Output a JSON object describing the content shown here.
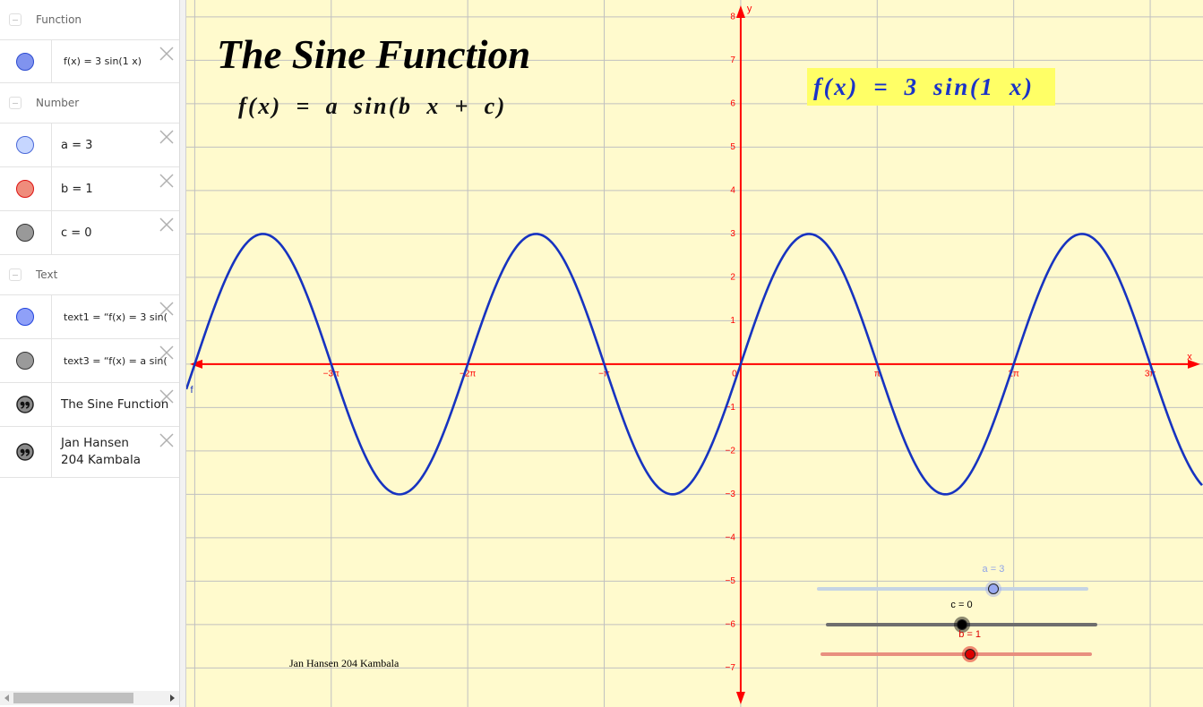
{
  "algebra": {
    "headers": {
      "function": "Function",
      "number": "Number",
      "text": "Text"
    },
    "rows": [
      {
        "text": "f(x)  =  3  sin(1 x)",
        "icon": "dot",
        "fill": "#8093ef",
        "stroke": "#2c4bd0"
      },
      {
        "text": "a = 3",
        "icon": "dot",
        "fill": "#c6d6ff",
        "stroke": "#4a68d8"
      },
      {
        "text": "b = 1",
        "icon": "dot",
        "fill": "#ef8c7c",
        "stroke": "#dd1111"
      },
      {
        "text": "c = 0",
        "icon": "dot",
        "fill": "#999999",
        "stroke": "#333333"
      },
      {
        "text": "text1  =  “f(x)  =  3  sin(",
        "icon": "dot",
        "fill": "#8fa0f8",
        "stroke": "#2244dd"
      },
      {
        "text": "text3  =  “f(x)  =  a  sin(",
        "icon": "dot",
        "fill": "#9a9a9a",
        "stroke": "#333333"
      },
      {
        "text": "The Sine Function",
        "icon": "quote"
      },
      {
        "text": "Jan Hansen 204 Kambala",
        "icon": "quote"
      }
    ],
    "scroll": {
      "position": 0,
      "thumb_fraction": 0.7
    }
  },
  "graphics": {
    "title": "The Sine Function",
    "formula": "f(x) = a sin(b x + c)",
    "highlight": {
      "text": "f(x) = 3 sin(1 x)",
      "background": "#ffff66",
      "color": "#1a33c8"
    },
    "author": "Jan Hansen 204 Kambala",
    "background": "#fffacd"
  },
  "sliders": [
    {
      "name": "a",
      "label": "a = 3",
      "value": 3,
      "position": 0.65,
      "label_color": "#8fa3e8",
      "track": "#c5d4e4",
      "knob": "#99a9f0"
    },
    {
      "name": "c",
      "label": "c = 0",
      "value": 0,
      "position": 0.5,
      "label_color": "#000000",
      "track": "#6e6e6e",
      "knob": "#000000"
    },
    {
      "name": "b",
      "label": "b = 1",
      "value": 1,
      "position": 0.55,
      "label_color": "#dd0000",
      "track": "#e88f7f",
      "knob": "#dd0000"
    }
  ],
  "chart_data": {
    "type": "line",
    "title": "",
    "xlabel": "x",
    "ylabel": "y",
    "origin_label": "0",
    "xlim": [
      -12.76,
      10.64
    ],
    "ylim": [
      -7.9,
      8.39
    ],
    "grid": true,
    "x_grid_step": 3.14159265,
    "y_grid_step": 1,
    "axis_color": "#ff0000",
    "grid_color": "#c0c0c0",
    "x_ticks": [
      {
        "value": -9.42478,
        "label": "−3π"
      },
      {
        "value": -6.28319,
        "label": "−2π"
      },
      {
        "value": -3.14159,
        "label": "−π"
      },
      {
        "value": 3.14159,
        "label": "π"
      },
      {
        "value": 6.28319,
        "label": "2π"
      },
      {
        "value": 9.42478,
        "label": "3π"
      }
    ],
    "y_ticks": [
      {
        "value": 8,
        "label": "8"
      },
      {
        "value": 7,
        "label": "7"
      },
      {
        "value": 6,
        "label": "6"
      },
      {
        "value": 5,
        "label": "5"
      },
      {
        "value": 4,
        "label": "4"
      },
      {
        "value": 3,
        "label": "3"
      },
      {
        "value": 2,
        "label": "2"
      },
      {
        "value": 1,
        "label": "1"
      },
      {
        "value": -1,
        "label": "−1"
      },
      {
        "value": -2,
        "label": "−2"
      },
      {
        "value": -3,
        "label": "−3"
      },
      {
        "value": -4,
        "label": "−4"
      },
      {
        "value": -5,
        "label": "−5"
      },
      {
        "value": -6,
        "label": "−6"
      },
      {
        "value": -7,
        "label": "−7"
      }
    ],
    "series": [
      {
        "name": "f",
        "expression": "f(x) = 3 sin(1 x)",
        "a": 3,
        "b": 1,
        "c": 0,
        "color": "#1733c0"
      }
    ]
  }
}
